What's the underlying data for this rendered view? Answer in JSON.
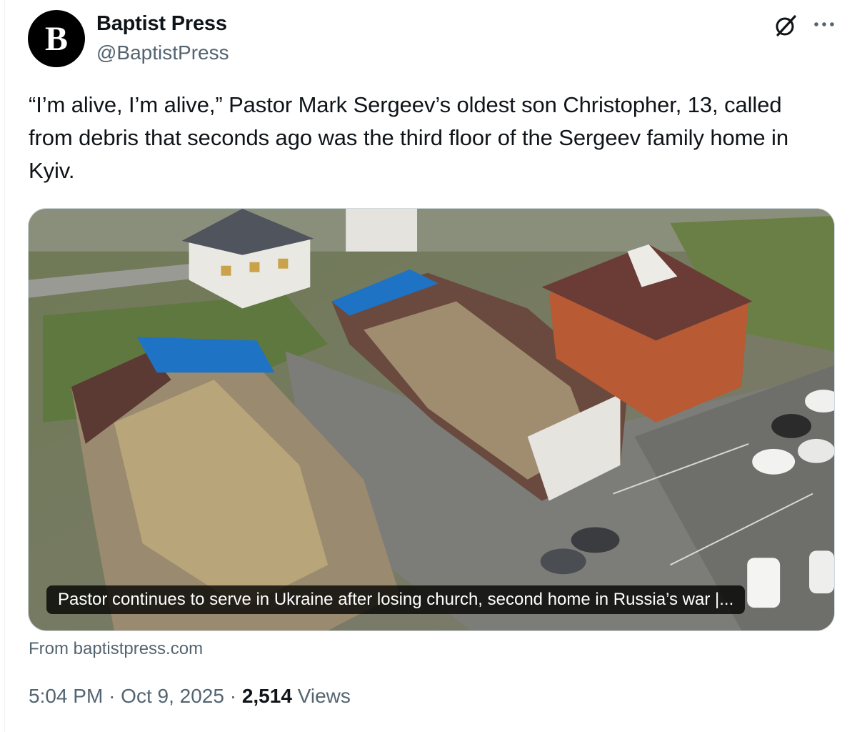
{
  "author": {
    "avatar_letter": "B",
    "display_name": "Baptist Press",
    "handle": "@BaptistPress"
  },
  "tweet": {
    "text": "“I’m alive, I’m alive,” Pastor Mark Sergeev’s oldest son Christopher, 13, called from debris that seconds ago was the third floor of the Sergeev family home in Kyiv."
  },
  "link_card": {
    "caption": "Pastor continues to serve in Ukraine after losing church, second home in Russia’s war |...",
    "source": "From baptistpress.com",
    "image_description_icon": "aerial-photo-bombed-houses"
  },
  "meta": {
    "time": "5:04 PM",
    "separator": "·",
    "date": "Oct 9, 2025",
    "views_count": "2,514",
    "views_label": "Views"
  },
  "icons": {
    "grok": "grok-icon",
    "more": "more-options-icon"
  },
  "colors": {
    "text_primary": "#0f1419",
    "text_secondary": "#536471",
    "border": "#cfd9de",
    "avatar_bg": "#000000"
  }
}
